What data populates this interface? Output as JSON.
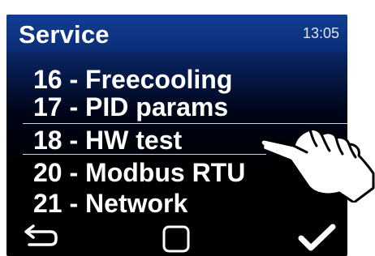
{
  "header": {
    "title": "Service",
    "time": "13:05"
  },
  "menu": {
    "items": [
      {
        "label": "16 - Freecooling"
      },
      {
        "label": "17 - PID params"
      },
      {
        "label": "18 - HW test",
        "selected": true
      },
      {
        "label": "20 - Modbus RTU"
      },
      {
        "label": "21 - Network"
      }
    ]
  },
  "footer": {
    "back_icon": "back-arrow-icon",
    "middle_icon": "square-icon",
    "confirm_icon": "checkmark-icon"
  },
  "colors": {
    "topbar": "#123e92",
    "text": "#ffffff",
    "background_dark": "#000000"
  }
}
